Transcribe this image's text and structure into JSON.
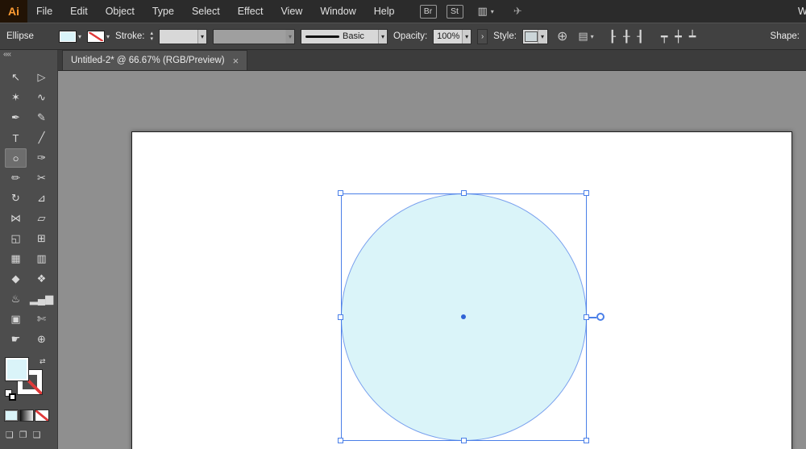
{
  "colors": {
    "menubar_bg": "#2b2b2b",
    "controlbar_bg": "#414141",
    "sidebar_bg": "#4d4d4d",
    "tabbar_bg": "#3c3c3c",
    "tab_active_bg": "#545454",
    "canvas_bg": "#8f8f8f",
    "artboard_bg": "#ffffff",
    "shape_fill": "#daf4f9",
    "selection_blue": "#4a7fe8",
    "accent_orange": "#ff9c32",
    "combo_bg": "#d8d8d8",
    "none_red": "#e03a3a",
    "text_light": "#e0e0e0"
  },
  "menubar": {
    "logo": "Ai",
    "items": [
      {
        "name": "menu-file",
        "label": "File"
      },
      {
        "name": "menu-edit",
        "label": "Edit"
      },
      {
        "name": "menu-object",
        "label": "Object"
      },
      {
        "name": "menu-type",
        "label": "Type"
      },
      {
        "name": "menu-select",
        "label": "Select"
      },
      {
        "name": "menu-effect",
        "label": "Effect"
      },
      {
        "name": "menu-view",
        "label": "View"
      },
      {
        "name": "menu-window",
        "label": "Window"
      },
      {
        "name": "menu-help",
        "label": "Help"
      }
    ],
    "badges": [
      {
        "name": "bridge-badge",
        "label": "Br"
      },
      {
        "name": "stock-badge",
        "label": "St"
      }
    ],
    "right_text": "W"
  },
  "controlbar": {
    "tool_label": "Ellipse",
    "stroke_label": "Stroke:",
    "stroke_weight_value": "",
    "width_profile_value": "",
    "brush_value": "Basic",
    "opacity_label": "Opacity:",
    "opacity_value": "100%",
    "style_label": "Style:",
    "shape_label": "Shape:"
  },
  "icons": {
    "chevron": "▾",
    "stepper_up": "▴",
    "stepper_down": "▾",
    "panel_arrow": "›",
    "globe": "⊕",
    "arrange": "▤",
    "share": "✈",
    "workspace": "▥",
    "collapse": "««",
    "close": "×",
    "swap": "⇄",
    "draw_normal": "❏",
    "draw_behind": "❐",
    "draw_inside": "❑"
  },
  "align_icons": [
    {
      "name": "align-horizontal-left-icon",
      "glyph": "┠"
    },
    {
      "name": "align-horizontal-center-icon",
      "glyph": "╂"
    },
    {
      "name": "align-horizontal-right-icon",
      "glyph": "┨"
    },
    {
      "name": "align-vertical-top-icon",
      "glyph": "┯"
    },
    {
      "name": "align-vertical-center-icon",
      "glyph": "┿"
    },
    {
      "name": "align-vertical-bottom-icon",
      "glyph": "┷"
    }
  ],
  "tabbar": {
    "title": "Untitled-2* @ 66.67% (RGB/Preview)"
  },
  "toolbar": {
    "tools": [
      {
        "name": "selection-tool",
        "glyph": "↖"
      },
      {
        "name": "direct-selection-tool",
        "glyph": "▷"
      },
      {
        "name": "magic-wand-tool",
        "glyph": "✶"
      },
      {
        "name": "lasso-tool",
        "glyph": "∿"
      },
      {
        "name": "pen-tool",
        "glyph": "✒"
      },
      {
        "name": "curvature-tool",
        "glyph": "✎"
      },
      {
        "name": "type-tool",
        "glyph": "T"
      },
      {
        "name": "line-segment-tool",
        "glyph": "╱"
      },
      {
        "name": "ellipse-tool",
        "glyph": "○",
        "selected": true
      },
      {
        "name": "paintbrush-tool",
        "glyph": "✑"
      },
      {
        "name": "pencil-tool",
        "glyph": "✏"
      },
      {
        "name": "scissors-tool",
        "glyph": "✂"
      },
      {
        "name": "rotate-tool",
        "glyph": "↻"
      },
      {
        "name": "scale-tool",
        "glyph": "⊿"
      },
      {
        "name": "width-tool",
        "glyph": "⋈"
      },
      {
        "name": "free-transform-tool",
        "glyph": "▱"
      },
      {
        "name": "shape-builder-tool",
        "glyph": "◱"
      },
      {
        "name": "perspective-grid-tool",
        "glyph": "⊞"
      },
      {
        "name": "mesh-tool",
        "glyph": "▦"
      },
      {
        "name": "gradient-tool",
        "glyph": "▥"
      },
      {
        "name": "eyedropper-tool",
        "glyph": "◆"
      },
      {
        "name": "blend-tool",
        "glyph": "❖"
      },
      {
        "name": "symbol-sprayer-tool",
        "glyph": "♨"
      },
      {
        "name": "column-graph-tool",
        "glyph": "▂▄▆"
      },
      {
        "name": "artboard-tool",
        "glyph": "▣"
      },
      {
        "name": "slice-tool",
        "glyph": "✄"
      },
      {
        "name": "hand-tool",
        "glyph": "☛"
      },
      {
        "name": "zoom-tool",
        "glyph": "⊕"
      }
    ]
  },
  "canvas": {
    "shape": {
      "type": "ellipse",
      "fill": "#daf4f9",
      "stroke": "none",
      "selected": true
    }
  }
}
